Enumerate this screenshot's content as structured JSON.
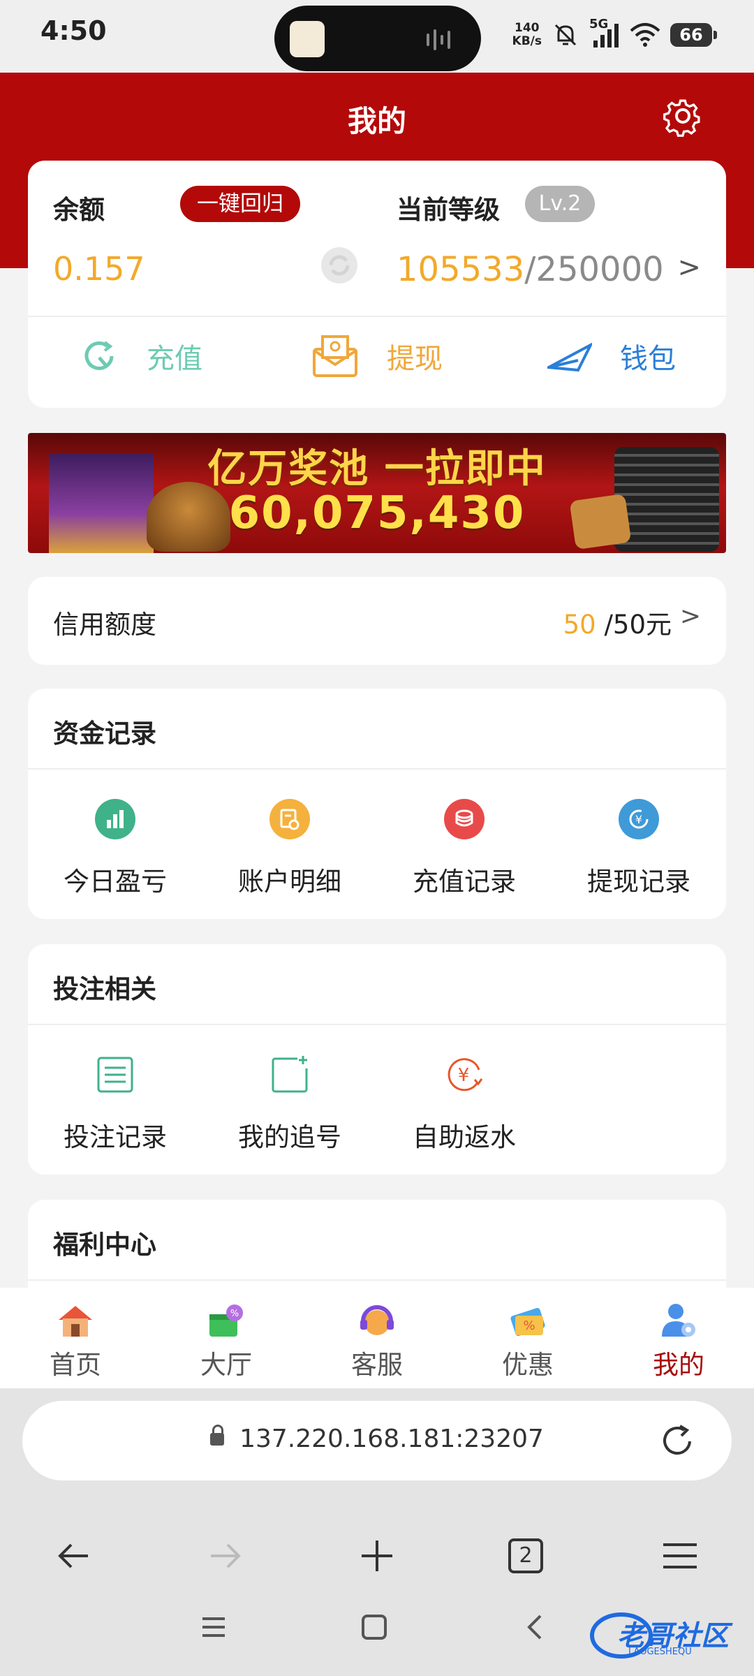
{
  "status_bar": {
    "time": "4:50",
    "net_speed_value": "140",
    "net_speed_unit": "KB/s",
    "signal_label": "5G",
    "battery": "66"
  },
  "header": {
    "title": "我的",
    "settings_icon": "gear-icon"
  },
  "balance": {
    "label": "余额",
    "recall_button": "一键回归",
    "value": "0.157",
    "level_label": "当前等级",
    "level_badge": "Lv.2",
    "level_current": "105533",
    "level_target": "/250000",
    "arrow": ">"
  },
  "actions": [
    {
      "label": "充值",
      "icon": "recharge-icon",
      "color": "#6ccbb2"
    },
    {
      "label": "提现",
      "icon": "withdraw-envelope-icon",
      "color": "#f0a73a"
    },
    {
      "label": "钱包",
      "icon": "wallet-plane-icon",
      "color": "#2b7fd8"
    }
  ],
  "banner": {
    "title": "亿万奖池 一拉即中",
    "amount": "60,075,430"
  },
  "credit": {
    "label": "信用额度",
    "current": "50",
    "total": " /50元",
    "arrow": ">"
  },
  "fund_records": {
    "title": "资金记录",
    "items": [
      {
        "label": "今日盈亏",
        "icon": "chart-bar-icon",
        "color": "#3fb28a"
      },
      {
        "label": "账户明细",
        "icon": "document-search-icon",
        "color": "#f5b13d"
      },
      {
        "label": "充值记录",
        "icon": "coins-icon",
        "color": "#e84a4a"
      },
      {
        "label": "提现记录",
        "icon": "yuan-cycle-icon",
        "color": "#3f9ad8"
      }
    ]
  },
  "bet": {
    "title": "投注相关",
    "items": [
      {
        "label": "投注记录",
        "icon": "list-icon",
        "color": "#3fb28a"
      },
      {
        "label": "我的追号",
        "icon": "add-square-icon",
        "color": "#3fb28a"
      },
      {
        "label": "自助返水",
        "icon": "yuan-refresh-icon",
        "color": "#e8552a"
      }
    ]
  },
  "welfare": {
    "title": "福利中心"
  },
  "bottom_nav": [
    {
      "label": "首页",
      "icon": "house-icon"
    },
    {
      "label": "大厅",
      "icon": "gift-icon"
    },
    {
      "label": "客服",
      "icon": "headset-icon"
    },
    {
      "label": "优惠",
      "icon": "ticket-icon"
    },
    {
      "label": "我的",
      "icon": "user-icon",
      "active": true
    }
  ],
  "browser": {
    "url": "137.220.168.181:23207",
    "tab_count": "2"
  },
  "watermark": {
    "text": "老哥社区",
    "subtext": "LAOGESHEQU"
  }
}
